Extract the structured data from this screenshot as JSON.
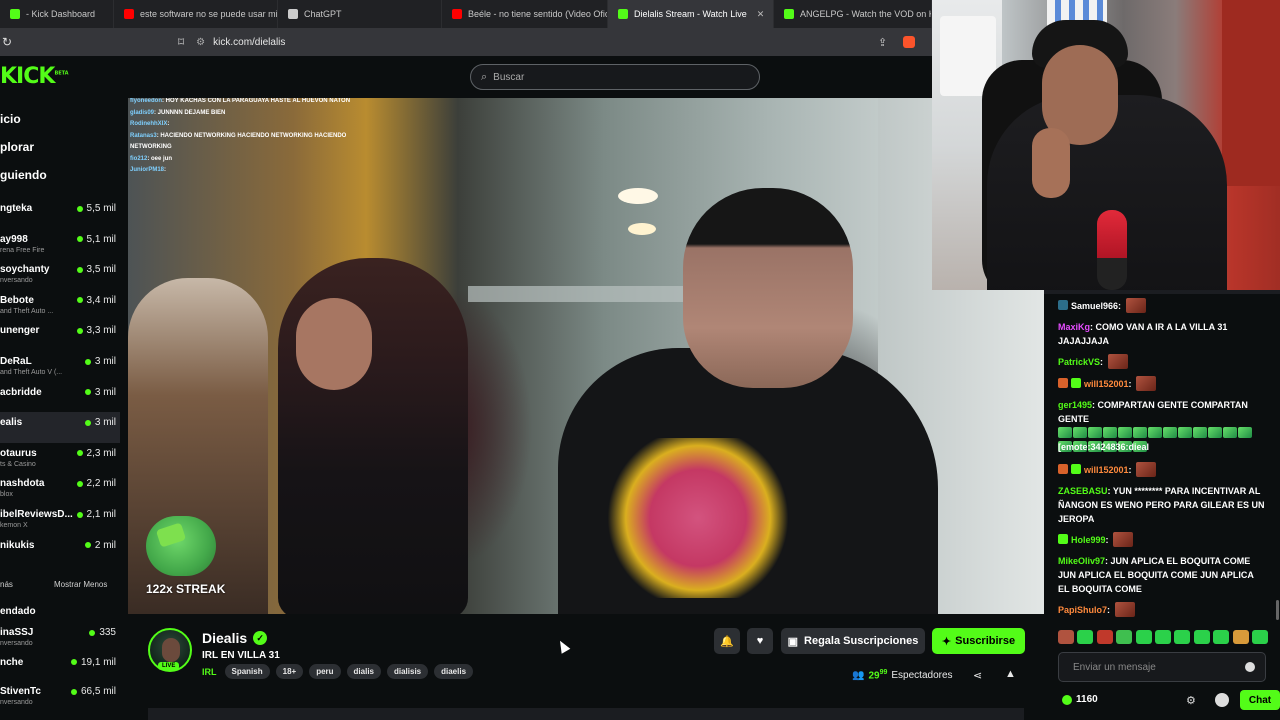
{
  "browser": {
    "tabs": [
      {
        "title": "- Kick Dashboard",
        "icon": "kick-icon",
        "color": "#53fc18",
        "active": false
      },
      {
        "title": "este software no se puede usar mie",
        "icon": "youtube-icon",
        "color": "#ff0000",
        "active": false
      },
      {
        "title": "ChatGPT",
        "icon": "chatgpt-icon",
        "color": "#cccccc",
        "active": false
      },
      {
        "title": "Beéle - no tiene sentido (Video Ofic",
        "icon": "youtube-icon",
        "color": "#ff0000",
        "active": false
      },
      {
        "title": "Dielalis Stream - Watch Live",
        "icon": "kick-icon",
        "color": "#53fc18",
        "active": true
      },
      {
        "title": "ANGELPG - Watch the VOD on Kic",
        "icon": "kick-icon",
        "color": "#53fc18",
        "active": false
      }
    ],
    "close_glyph": "✕",
    "url": "kick.com/dielalis"
  },
  "header": {
    "logo": "KICK",
    "logo_sup": "BETA",
    "search_placeholder": "Buscar"
  },
  "sidebar": {
    "nav": [
      "icio",
      "plorar",
      "guiendo"
    ],
    "channels": [
      {
        "name": "ngteka",
        "category": "",
        "viewers": "5,5 mil",
        "active": false
      },
      {
        "name": "ay998",
        "category": "rena Free Fire",
        "viewers": "5,1 mil",
        "active": false
      },
      {
        "name": "soychanty",
        "category": "nversando",
        "viewers": "3,5 mil",
        "active": false
      },
      {
        "name": "Bebote",
        "category": "and Theft Auto ...",
        "viewers": "3,4 mil",
        "active": false
      },
      {
        "name": "unenger",
        "category": "",
        "viewers": "3,3 mil",
        "active": false
      },
      {
        "name": "DeRaL",
        "category": "and Theft Auto V (...",
        "viewers": "3 mil",
        "active": false
      },
      {
        "name": "acbridde",
        "category": "",
        "viewers": "3 mil",
        "active": false
      },
      {
        "name": "ealis",
        "category": "",
        "viewers": "3 mil",
        "active": true
      },
      {
        "name": "otaurus",
        "category": "ts & Casino",
        "viewers": "2,3 mil",
        "active": false
      },
      {
        "name": "nashdota",
        "category": "blox",
        "viewers": "2,2 mil",
        "active": false
      },
      {
        "name": "ibelReviewsD...",
        "category": "kemon X",
        "viewers": "2,1 mil",
        "active": false
      },
      {
        "name": "nikukis",
        "category": "",
        "viewers": "2 mil",
        "active": false
      }
    ],
    "show_more": "nás",
    "show_less": "Mostrar Menos",
    "section_recommended": "endado",
    "recommended": [
      {
        "name": "inaSSJ",
        "category": "nversando",
        "viewers": "335"
      },
      {
        "name": "nche",
        "category": "",
        "viewers": "19,1 mil"
      },
      {
        "name": "StivenTc",
        "category": "nversando",
        "viewers": "66,5 mil"
      }
    ]
  },
  "video_overlay": {
    "chat": [
      {
        "user": "flyoneedon",
        "text": ": HOY KACHAS CON LA PARAGUAYA HASTE AL HUEVON ÑATON"
      },
      {
        "user": "gladis09",
        "text": ": JUNNNN DEJAME BIEN"
      },
      {
        "user": "RodinehhXIX",
        "text": ":"
      },
      {
        "user": "Ratanas3",
        "text": ": HACIENDO NETWORKING HACIENDO NETWORKING HACIENDO NETWORKING"
      },
      {
        "user": "fio212",
        "text": ": oee jun"
      },
      {
        "user": "JuniorPM18",
        "text": ":"
      }
    ],
    "streak": "122x STREAK"
  },
  "stream": {
    "channel_name": "Diealis",
    "live_badge": "LIVE",
    "title": "IRL EN VILLA 31",
    "category": "IRL",
    "tags": [
      "Spanish",
      "18+",
      "peru",
      "dialis",
      "dialisis",
      "diaelis"
    ],
    "gift_label": "Regala Suscripciones",
    "subscribe_label": "Suscribirse",
    "viewers_main": "29",
    "viewers_sup": "99",
    "viewers_label": "Espectadores",
    "bell_icon": "🔔",
    "heart_icon": "♥",
    "share_icon": "⋖",
    "warning_icon": "▲"
  },
  "chat": {
    "messages": [
      {
        "user": "Samuel966",
        "color": "#ffffff",
        "badges": [
          "#2c6e8a"
        ],
        "text": "",
        "emotes": 1,
        "greens": 0
      },
      {
        "user": "MaxiKg",
        "color": "#e64dff",
        "badges": [],
        "text": "COMO VAN A IR A LA VILLA 31 JAJAJJAJA",
        "emotes": 0,
        "greens": 0
      },
      {
        "user": "PatrickVS",
        "color": "#53fc18",
        "badges": [],
        "text": "",
        "emotes": 1,
        "greens": 0
      },
      {
        "user": "will152001",
        "color": "#ff8a3d",
        "badges": [
          "#d9622b",
          "#53fc18"
        ],
        "text": "",
        "emotes": 1,
        "greens": 0
      },
      {
        "user": "ger1495",
        "color": "#53fc18",
        "badges": [],
        "text": "COMPARTAN GENTE COMPARTAN GENTE",
        "emotes": 0,
        "greens": 19
      },
      {
        "user": "",
        "color": "#ffffff",
        "badges": [],
        "text": "[emote:3424836:dieal",
        "emotes": 0,
        "greens": 0
      },
      {
        "user": "will152001",
        "color": "#ff8a3d",
        "badges": [
          "#d9622b",
          "#53fc18"
        ],
        "text": "",
        "emotes": 1,
        "greens": 0
      },
      {
        "user": "ZASEBASU",
        "color": "#53fc18",
        "badges": [],
        "text": "YUN ******** PARA INCENTIVAR AL ÑANGON ES WENO PERO PARA GILEAR ES UN JEROPA",
        "emotes": 0,
        "greens": 0
      },
      {
        "user": "Hole999",
        "color": "#53fc18",
        "badges": [
          "#53fc18"
        ],
        "text": "",
        "emotes": 1,
        "greens": 0
      },
      {
        "user": "MikeOliv97",
        "color": "#53fc18",
        "badges": [],
        "text": "JUN APLICA EL BOQUITA COME JUN APLICA EL BOQUITA COME JUN APLICA EL BOQUITA COME",
        "emotes": 0,
        "greens": 0
      },
      {
        "user": "PapiShulo7",
        "color": "#ff8a3d",
        "badges": [],
        "text": "",
        "emotes": 1,
        "greens": 0
      }
    ],
    "emote_bar": [
      "#b0533f",
      "#2bd14a",
      "#c0392b",
      "#3fbf4f",
      "#2bd14a",
      "#2bd14a",
      "#2bd14a",
      "#2bd14a",
      "#2bd14a",
      "#d89a3a",
      "#2bd14a"
    ],
    "input_placeholder": "Enviar un mensaje",
    "points": "1160",
    "gear_icon": "⚙",
    "chat_button": "Chat"
  }
}
